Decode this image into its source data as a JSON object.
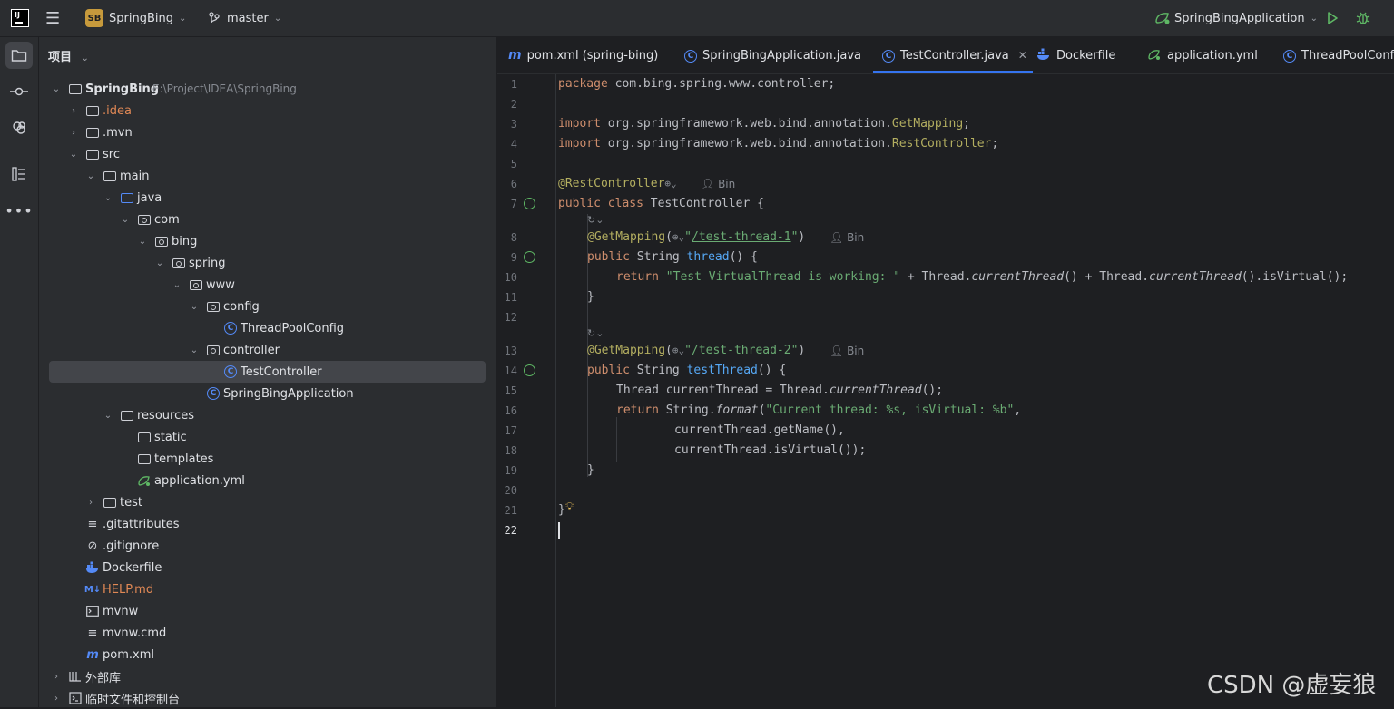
{
  "topbar": {
    "project_badge": "SB",
    "project_name": "SpringBing",
    "branch": "master",
    "run_config": "SpringBingApplication"
  },
  "project_panel": {
    "title": "项目",
    "root_name": "SpringBing",
    "root_path": "E:\\Project\\IDEA\\SpringBing",
    "items": [
      {
        "label": ".idea"
      },
      {
        "label": ".mvn"
      },
      {
        "label": "src"
      },
      {
        "label": "main"
      },
      {
        "label": "java"
      },
      {
        "label": "com"
      },
      {
        "label": "bing"
      },
      {
        "label": "spring"
      },
      {
        "label": "www"
      },
      {
        "label": "config"
      },
      {
        "label": "ThreadPoolConfig"
      },
      {
        "label": "controller"
      },
      {
        "label": "TestController"
      },
      {
        "label": "SpringBingApplication"
      },
      {
        "label": "resources"
      },
      {
        "label": "static"
      },
      {
        "label": "templates"
      },
      {
        "label": "application.yml"
      },
      {
        "label": "test"
      },
      {
        "label": ".gitattributes"
      },
      {
        "label": ".gitignore"
      },
      {
        "label": "Dockerfile"
      },
      {
        "label": "HELP.md"
      },
      {
        "label": "mvnw"
      },
      {
        "label": "mvnw.cmd"
      },
      {
        "label": "pom.xml"
      },
      {
        "label": "外部库"
      },
      {
        "label": "临时文件和控制台"
      }
    ]
  },
  "tabs": [
    {
      "label": "pom.xml (spring-bing)"
    },
    {
      "label": "SpringBingApplication.java"
    },
    {
      "label": "TestController.java"
    },
    {
      "label": "Dockerfile"
    },
    {
      "label": "application.yml"
    },
    {
      "label": "ThreadPoolConfig"
    }
  ],
  "editor": {
    "line_numbers": [
      "1",
      "2",
      "3",
      "4",
      "5",
      "6",
      "7",
      "8",
      "9",
      "10",
      "11",
      "12",
      "13",
      "14",
      "15",
      "16",
      "17",
      "18",
      "19",
      "20",
      "21",
      "22"
    ],
    "author_hint": "Bin",
    "code": {
      "l1_kw": "package",
      "l1_rest": " com.bing.spring.www.controller;",
      "l3_kw": "import",
      "l3_rest": " org.springframework.web.bind.annotation.",
      "l3_cls": "GetMapping",
      "l3_end": ";",
      "l4_kw": "import",
      "l4_rest": " org.springframework.web.bind.annotation.",
      "l4_cls": "RestController",
      "l4_end": ";",
      "l6_ann": "@RestController",
      "l7_kw": "public class",
      "l7_rest": " TestController {",
      "l8_ann": "@GetMapping",
      "l8_open": "(",
      "l8_q1": "\"",
      "l8_url": "/test-thread-1",
      "l8_q2": "\"",
      "l8_close": ")",
      "l9_kw": "public",
      "l9_type": " String ",
      "l9_fn": "thread",
      "l9_rest": "() {",
      "l10_kw": "return",
      "l10_str": " \"Test VirtualThread is working: \"",
      "l10_a": " + Thread.",
      "l10_it1": "currentThread",
      "l10_b": "() + Thread.",
      "l10_it2": "currentThread",
      "l10_c": "().isVirtual();",
      "l11": "}",
      "l13_ann": "@GetMapping",
      "l13_open": "(",
      "l13_q1": "\"",
      "l13_url": "/test-thread-2",
      "l13_q2": "\"",
      "l13_close": ")",
      "l14_kw": "public",
      "l14_type": " String ",
      "l14_fn": "testThread",
      "l14_rest": "() {",
      "l15_a": "Thread currentThread = Thread.",
      "l15_it": "currentThread",
      "l15_b": "();",
      "l16_kw": "return",
      "l16_a": " String.",
      "l16_it": "format",
      "l16_b": "(",
      "l16_str": "\"Current thread: %s, isVirtual: %b\"",
      "l16_c": ",",
      "l17": "currentThread.getName(),",
      "l18": "currentThread.isVirtual());",
      "l19": "}",
      "l21": "}"
    }
  },
  "watermark": "CSDN @虚妄狼"
}
